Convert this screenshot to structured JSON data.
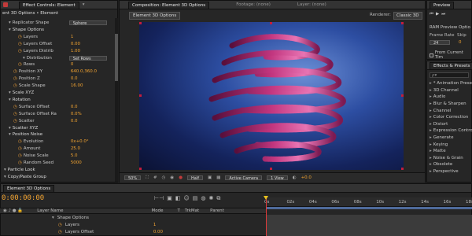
{
  "colors": {
    "accent": "#f3a431",
    "panel": "#262626",
    "header": "#333333",
    "timeline_bar": "#c0282f"
  },
  "effect_controls": {
    "tabs": [
      "Effect Controls: Element",
      "▾"
    ],
    "breadcrumb": "ent 3D Options • Element",
    "rows": [
      {
        "indent": 10,
        "icon": "tri",
        "label": "Replicator Shape",
        "value": "Sphere",
        "kind": "dropdown"
      },
      {
        "indent": 10,
        "icon": "tri",
        "label": "Shape Options",
        "value": "",
        "kind": "group"
      },
      {
        "indent": 22,
        "icon": "stop",
        "label": "Layers",
        "value": "1",
        "kind": "num"
      },
      {
        "indent": 22,
        "icon": "stop",
        "label": "Layers Offset",
        "value": "0.00",
        "kind": "num"
      },
      {
        "indent": 22,
        "icon": "stop",
        "label": "Layers Distrib",
        "value": "1.00",
        "kind": "num"
      },
      {
        "indent": 28,
        "icon": "tri",
        "label": "Distribution",
        "value": "Set Rows",
        "kind": "dropdown"
      },
      {
        "indent": 22,
        "icon": "stop",
        "label": "Rows",
        "value": "0",
        "kind": "num"
      },
      {
        "indent": 16,
        "icon": "stop",
        "label": "Position XY",
        "value": "640.0,360.0",
        "kind": "num"
      },
      {
        "indent": 16,
        "icon": "stop",
        "label": "Position Z",
        "value": "0.0",
        "kind": "num"
      },
      {
        "indent": 16,
        "icon": "stop",
        "label": "Scale Shape",
        "value": "16.00",
        "kind": "num"
      },
      {
        "indent": 10,
        "icon": "tri",
        "label": "Scale XYZ",
        "value": "",
        "kind": "group"
      },
      {
        "indent": 10,
        "icon": "tri",
        "label": "Rotation",
        "value": "",
        "kind": "group"
      },
      {
        "indent": 16,
        "icon": "stop",
        "label": "Surface Offset",
        "value": "0.0",
        "kind": "num"
      },
      {
        "indent": 16,
        "icon": "stop",
        "label": "Surface Offset Ra",
        "value": "0.0%",
        "kind": "num"
      },
      {
        "indent": 16,
        "icon": "stop",
        "label": "Scatter",
        "value": "0.0",
        "kind": "num"
      },
      {
        "indent": 10,
        "icon": "tri",
        "label": "Scatter XYZ",
        "value": "",
        "kind": "group"
      },
      {
        "indent": 10,
        "icon": "tri",
        "label": "Position Noise",
        "value": "",
        "kind": "group"
      },
      {
        "indent": 22,
        "icon": "stop",
        "label": "Evolution",
        "value": "0x+0.0°",
        "kind": "num"
      },
      {
        "indent": 22,
        "icon": "stop",
        "label": "Amount",
        "value": "25.0",
        "kind": "num"
      },
      {
        "indent": 22,
        "icon": "stop",
        "label": "Noise Scale",
        "value": "5.0",
        "kind": "num"
      },
      {
        "indent": 22,
        "icon": "stop",
        "label": "Random Seed",
        "value": "5000",
        "kind": "num"
      },
      {
        "indent": 4,
        "icon": "tri",
        "label": "Particle Look",
        "value": "",
        "kind": "group"
      },
      {
        "indent": 4,
        "icon": "tri",
        "label": "Copy/Paste Group",
        "value": "",
        "kind": "group"
      }
    ]
  },
  "composition": {
    "tabs": [
      "Composition: Element 3D Options",
      "Footage: (none)",
      "Layer: (none)"
    ],
    "sub_tab": "Element 3D Options",
    "renderer_label": "Renderer:",
    "renderer_value": "Classic 3D",
    "footer": {
      "zoom": "50%",
      "resolution": "Half",
      "camera": "Active Camera",
      "views": "1 View",
      "exposure": "+0.0"
    }
  },
  "preview": {
    "title": "Preview",
    "section": "RAM Preview Optio",
    "frame_rate_label": "Frame Rate",
    "frame_rate_value": "24",
    "skip_label": "Skip",
    "skip_value": "0",
    "checkbox_label": "From Current Tim"
  },
  "effects_presets": {
    "title": "Effects & Presets",
    "search_placeholder": "ρ▾",
    "items": [
      "* Animation Presets",
      "3D Channel",
      "Audio",
      "Blur & Sharpen",
      "Channel",
      "Color Correction",
      "Distort",
      "Expression Contro",
      "Generate",
      "Keying",
      "Matte",
      "Noise & Grain",
      "Obsolete",
      "Perspective"
    ]
  },
  "timeline": {
    "tab": "Element 3D Options",
    "timecode": "0:00:00:00",
    "columns": {
      "name": "Layer Name",
      "mode": "Mode",
      "t": "T",
      "trkmat": "TrkMat",
      "parent": "Parent"
    },
    "ruler": [
      "0s",
      "02s",
      "04s",
      "06s",
      "08s",
      "10s",
      "12s",
      "14s",
      "16s",
      "18s"
    ],
    "rows": [
      {
        "label": "Shape Options",
        "value": ""
      },
      {
        "label": "Layers",
        "value": "1"
      },
      {
        "label": "Layers Offset",
        "value": "0.00"
      }
    ]
  }
}
